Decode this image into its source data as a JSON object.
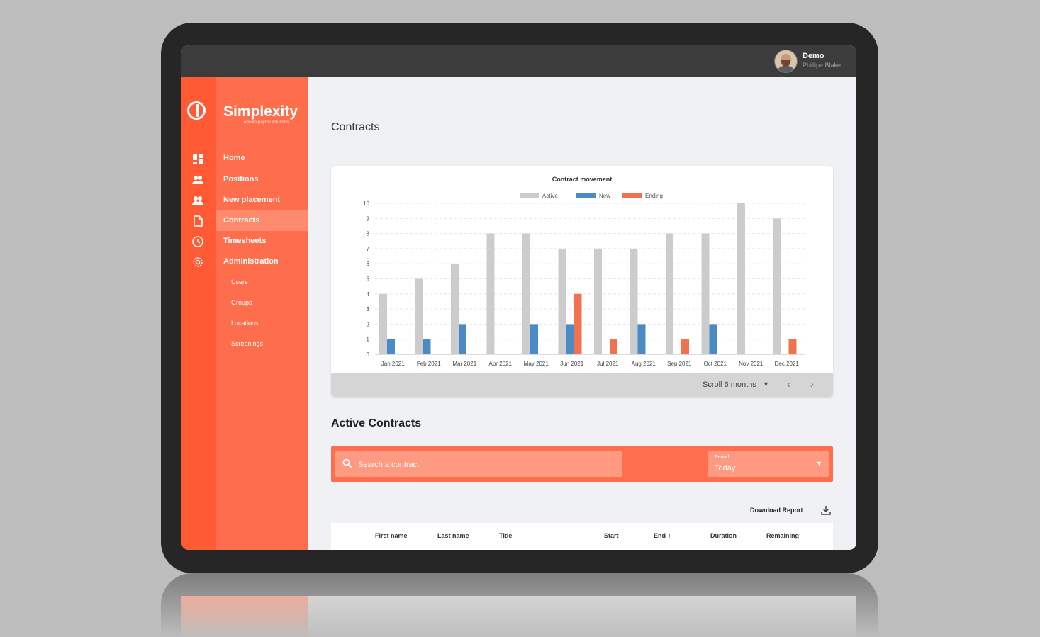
{
  "header": {
    "user_name": "Demo",
    "user_sub": "Phillipe Blake"
  },
  "brand": {
    "name": "Simplexity",
    "tagline": "encore payroll solutions"
  },
  "sidebar": {
    "items": [
      {
        "label": "Home",
        "icon": "dashboard-icon"
      },
      {
        "label": "Positions",
        "icon": "people-icon"
      },
      {
        "label": "New placement",
        "icon": "people-icon"
      },
      {
        "label": "Contracts",
        "icon": "document-icon",
        "active": true
      },
      {
        "label": "Timesheets",
        "icon": "clock-icon"
      },
      {
        "label": "Administration",
        "icon": "gear-icon"
      }
    ],
    "sub_items": [
      {
        "label": "Users"
      },
      {
        "label": "Groups"
      },
      {
        "label": "Locations"
      },
      {
        "label": "Screenings"
      }
    ]
  },
  "page": {
    "title": "Contracts"
  },
  "chart_footer": {
    "scroll_label": "Scroll 6 months"
  },
  "active_contracts": {
    "title": "Active Contracts",
    "search_placeholder": "Search a contract",
    "period_label": "Period",
    "period_value": "Today",
    "download_label": "Download Report"
  },
  "table": {
    "columns": [
      "First name",
      "Last name",
      "Title",
      "Start",
      "End",
      "Duration",
      "Remaining"
    ],
    "sort_indicator": "↑"
  },
  "colors": {
    "accent": "#ff6e4c",
    "active_bar": "#cccccc",
    "new_bar": "#4a8bc7",
    "ending_bar": "#f2714f"
  },
  "chart_data": {
    "type": "bar",
    "title": "Contract movement",
    "categories": [
      "Jan 2021",
      "Feb 2021",
      "Mar 2021",
      "Apr 2021",
      "May 2021",
      "Jun 2021",
      "Jul 2021",
      "Aug 2021",
      "Sep 2021",
      "Oct 2021",
      "Nov 2021",
      "Dec 2021"
    ],
    "series": [
      {
        "name": "Active",
        "color": "#cccccc",
        "values": [
          4,
          5,
          6,
          8,
          8,
          7,
          7,
          7,
          8,
          8,
          10,
          9
        ]
      },
      {
        "name": "New",
        "color": "#4a8bc7",
        "values": [
          1,
          1,
          2,
          0,
          2,
          2,
          0,
          2,
          0,
          2,
          0,
          0
        ]
      },
      {
        "name": "Ending",
        "color": "#f2714f",
        "values": [
          0,
          0,
          0,
          0,
          0,
          4,
          1,
          0,
          1,
          0,
          0,
          1
        ]
      }
    ],
    "y_ticks": [
      "0",
      "1",
      "2",
      "3",
      "4",
      "5",
      "6",
      "7",
      "8",
      "9",
      "10"
    ],
    "ylim": [
      0,
      10
    ],
    "legend_position": "top",
    "grid": true
  }
}
